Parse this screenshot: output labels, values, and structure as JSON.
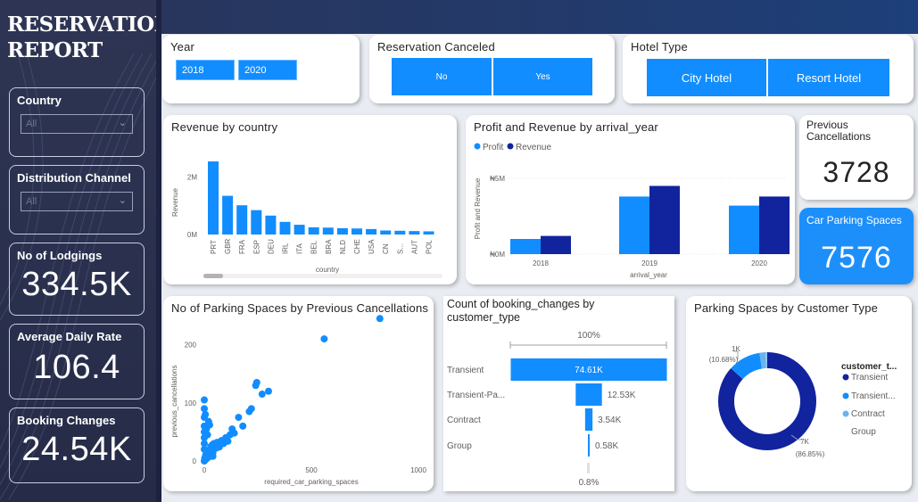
{
  "report": {
    "title": "RESERVATION\nREPORT"
  },
  "filters": {
    "country": {
      "label": "Country",
      "value": "All"
    },
    "distribution_channel": {
      "label": "Distribution Channel",
      "value": "All"
    },
    "year": {
      "label": "Year",
      "from": "2018",
      "to": "2020"
    },
    "reservation_canceled": {
      "label": "Reservation Canceled",
      "options": [
        "No",
        "Yes"
      ]
    },
    "hotel_type": {
      "label": "Hotel Type",
      "options": [
        "City Hotel",
        "Resort Hotel"
      ]
    }
  },
  "kpis": {
    "lodgings": {
      "label": "No of Lodgings",
      "value": "334.5K"
    },
    "adr": {
      "label": "Average Daily Rate",
      "value": "106.4"
    },
    "booking_changes": {
      "label": "Booking Changes",
      "value": "24.54K"
    },
    "prev_cancellations": {
      "label": "Previous Cancellations",
      "value": "3728"
    },
    "parking": {
      "label": "Car Parking Spaces",
      "value": "7576"
    }
  },
  "colors": {
    "blue": "#118dff",
    "navy": "#12239e",
    "light": "#6bb3f0",
    "kpi_blue": "#1c8ffb",
    "sidebar": "#2e3554"
  },
  "chart_data": [
    {
      "id": "revenue_by_country",
      "type": "bar",
      "title": "Revenue by country",
      "xlabel": "country",
      "ylabel": "Revenue",
      "y_ticks": [
        "0M",
        "2M"
      ],
      "categories": [
        "PRT",
        "GBR",
        "FRA",
        "ESP",
        "DEU",
        "IRL",
        "ITA",
        "BEL",
        "BRA",
        "NLD",
        "CHE",
        "USA",
        "CN",
        "S...",
        "AUT",
        "POL"
      ],
      "values": [
        2.55,
        1.35,
        1.02,
        0.85,
        0.66,
        0.44,
        0.34,
        0.25,
        0.24,
        0.22,
        0.21,
        0.19,
        0.14,
        0.13,
        0.12,
        0.11
      ],
      "ylim": [
        0,
        2.8
      ]
    },
    {
      "id": "profit_revenue_by_year",
      "type": "bar",
      "title": "Profit and Revenue by arrival_year",
      "xlabel": "arrival_year",
      "ylabel": "Profit and Revenue",
      "y_ticks": [
        "₦0M",
        "₦5M"
      ],
      "categories": [
        "2018",
        "2019",
        "2020"
      ],
      "series": [
        {
          "name": "Profit",
          "values": [
            1.0,
            3.8,
            3.2
          ]
        },
        {
          "name": "Revenue",
          "values": [
            1.2,
            4.5,
            3.8
          ]
        }
      ],
      "ylim": [
        0,
        5.0
      ]
    },
    {
      "id": "parking_by_prev_cancellations",
      "type": "scatter",
      "title": "No of Parking Spaces by Previous Cancellations",
      "xlabel": "required_car_parking_spaces",
      "ylabel": "previous_cancellations",
      "x_ticks": [
        "0",
        "500",
        "1000"
      ],
      "y_ticks": [
        "0",
        "100",
        "200"
      ],
      "xlim": [
        0,
        1000
      ],
      "ylim": [
        0,
        250
      ],
      "points": [
        [
          0,
          0
        ],
        [
          5,
          2
        ],
        [
          10,
          4
        ],
        [
          12,
          8
        ],
        [
          15,
          12
        ],
        [
          18,
          6
        ],
        [
          20,
          15
        ],
        [
          22,
          10
        ],
        [
          25,
          18
        ],
        [
          28,
          20
        ],
        [
          30,
          25
        ],
        [
          35,
          22
        ],
        [
          38,
          28
        ],
        [
          40,
          14
        ],
        [
          45,
          30
        ],
        [
          50,
          26
        ],
        [
          55,
          22
        ],
        [
          60,
          32
        ],
        [
          65,
          28
        ],
        [
          70,
          24
        ],
        [
          80,
          35
        ],
        [
          90,
          30
        ],
        [
          100,
          40
        ],
        [
          110,
          34
        ],
        [
          120,
          45
        ],
        [
          130,
          55
        ],
        [
          140,
          48
        ],
        [
          160,
          75
        ],
        [
          180,
          60
        ],
        [
          210,
          85
        ],
        [
          220,
          90
        ],
        [
          240,
          130
        ],
        [
          245,
          135
        ],
        [
          270,
          115
        ],
        [
          300,
          120
        ],
        [
          0,
          50
        ],
        [
          0,
          75
        ],
        [
          0,
          105
        ],
        [
          0,
          90
        ],
        [
          0,
          60
        ],
        [
          0,
          30
        ],
        [
          0,
          20
        ],
        [
          0,
          40
        ],
        [
          5,
          80
        ],
        [
          10,
          55
        ],
        [
          15,
          45
        ],
        [
          20,
          68
        ],
        [
          25,
          62
        ],
        [
          560,
          210
        ],
        [
          820,
          245
        ],
        [
          2,
          5
        ],
        [
          3,
          3
        ],
        [
          6,
          9
        ],
        [
          8,
          11
        ],
        [
          40,
          8
        ]
      ]
    },
    {
      "id": "booking_changes_by_customer_type",
      "type": "bar",
      "title": "Count of booking_changes by customer_type",
      "top_label": "100%",
      "bottom_label": "0.8%",
      "categories": [
        "Transient",
        "Transient-Pa...",
        "Contract",
        "Group"
      ],
      "values": [
        74.61,
        12.53,
        3.54,
        0.58
      ],
      "value_labels": [
        "74.61K",
        "12.53K",
        "3.54K",
        "0.58K"
      ]
    },
    {
      "id": "parking_by_customer_type",
      "type": "pie",
      "title": "Parking Spaces by Customer Type",
      "legend_title": "customer_t...",
      "legend": [
        "Transient",
        "Transient...",
        "Contract",
        "Group"
      ],
      "values": [
        6560,
        810,
        150,
        56
      ],
      "slice_labels": [
        {
          "value": "7K",
          "pct": "(86.85%)"
        },
        {
          "value": "1K",
          "pct": "(10.68%)"
        }
      ]
    }
  ]
}
